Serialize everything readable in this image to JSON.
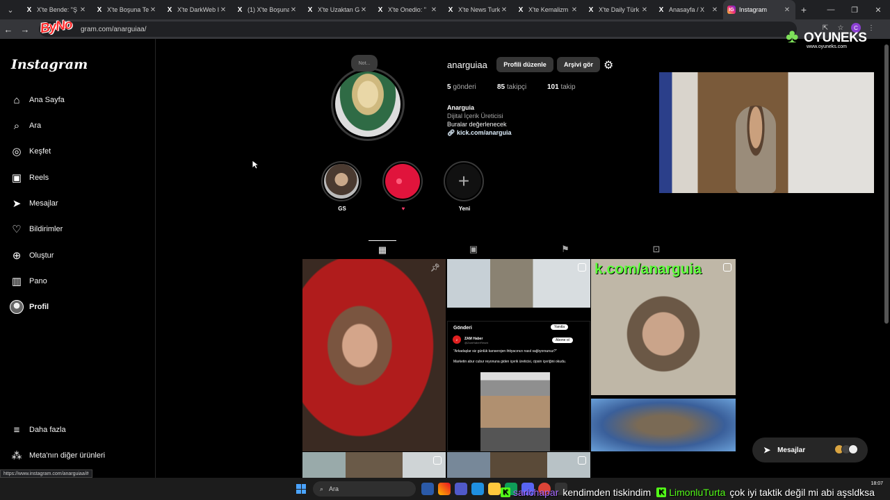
{
  "browser": {
    "tabs": [
      {
        "label": "X'te Bende: \"Ş",
        "fav": "X"
      },
      {
        "label": "X'te Boşuna Te",
        "fav": "X"
      },
      {
        "label": "X'te DarkWeb I",
        "fav": "X"
      },
      {
        "label": "(1) X'te Boşuna",
        "fav": "X"
      },
      {
        "label": "X'te Uzaktan G",
        "fav": "X"
      },
      {
        "label": "X'te Onedio: \"",
        "fav": "X"
      },
      {
        "label": "X'te News Turk",
        "fav": "X"
      },
      {
        "label": "X'te Kemalizm",
        "fav": "X"
      },
      {
        "label": "X'te Daily Türk",
        "fav": "X"
      },
      {
        "label": "Anasayfa / X",
        "fav": "X"
      },
      {
        "label": "Instagram",
        "fav": "IG"
      }
    ],
    "url": "gram.com/anarguiaa/",
    "status_url": "https://www.instagram.com/anarguiaa/#",
    "overlay_logo": "ByNo",
    "sponsor": {
      "name": "OYUNEKS",
      "sub": "www.oyuneks.com"
    }
  },
  "sidebar": {
    "logo": "Instagram",
    "items": [
      {
        "label": "Ana Sayfa",
        "icon": "⌂"
      },
      {
        "label": "Ara",
        "icon": "⌕"
      },
      {
        "label": "Keşfet",
        "icon": "◎"
      },
      {
        "label": "Reels",
        "icon": "▣"
      },
      {
        "label": "Mesajlar",
        "icon": "➤"
      },
      {
        "label": "Bildirimler",
        "icon": "♡"
      },
      {
        "label": "Oluştur",
        "icon": "⊕"
      },
      {
        "label": "Pano",
        "icon": "▥"
      },
      {
        "label": "Profil",
        "icon": ""
      }
    ],
    "more": {
      "label": "Daha fazla",
      "icon": "≡"
    },
    "meta": {
      "label": "Meta'nın diğer ürünleri",
      "icon": "⁂"
    }
  },
  "profile": {
    "note": "Not...",
    "username": "anarguiaa",
    "edit_label": "Profili düzenle",
    "archive_label": "Arşivi gör",
    "stats": [
      {
        "num": "5",
        "label": "gönderi"
      },
      {
        "num": "85",
        "label": "takipçi"
      },
      {
        "num": "101",
        "label": "takip"
      }
    ],
    "name": "Anarguia",
    "category": "Dijital İçerik Üreticisi",
    "bio": "Buralar değerlenecek",
    "link": "kick.com/anarguia"
  },
  "highlights": [
    {
      "label": "GS"
    },
    {
      "label": "♥"
    },
    {
      "label": "Yeni"
    }
  ],
  "grid": {
    "kick_text": "k.com/anarguia",
    "tweet": {
      "header": "Gönderi",
      "reply": "Yanıtla",
      "account": "ZAM Haber",
      "handle": "@ZamHaberResmi",
      "follow": "Abone ol",
      "quote": "\"Arkadaşlar siz günlük kanserojen ihtiyacınızı nasıl sağlıyorsunuz?\"",
      "text": "Marketin abur cubur reyonuna giden içerik üreticisi, cipsin içeriğini okudu."
    }
  },
  "float_messages": {
    "label": "Mesajlar"
  },
  "taskbar": {
    "search": "Ara",
    "time": "18:07"
  },
  "ticker": [
    {
      "user": "sarichapar",
      "msg": "kendimden tiskindim"
    },
    {
      "user": "LimonluTurta",
      "msg": "çok iyi taktik değil mi abi aşsldksa"
    }
  ]
}
